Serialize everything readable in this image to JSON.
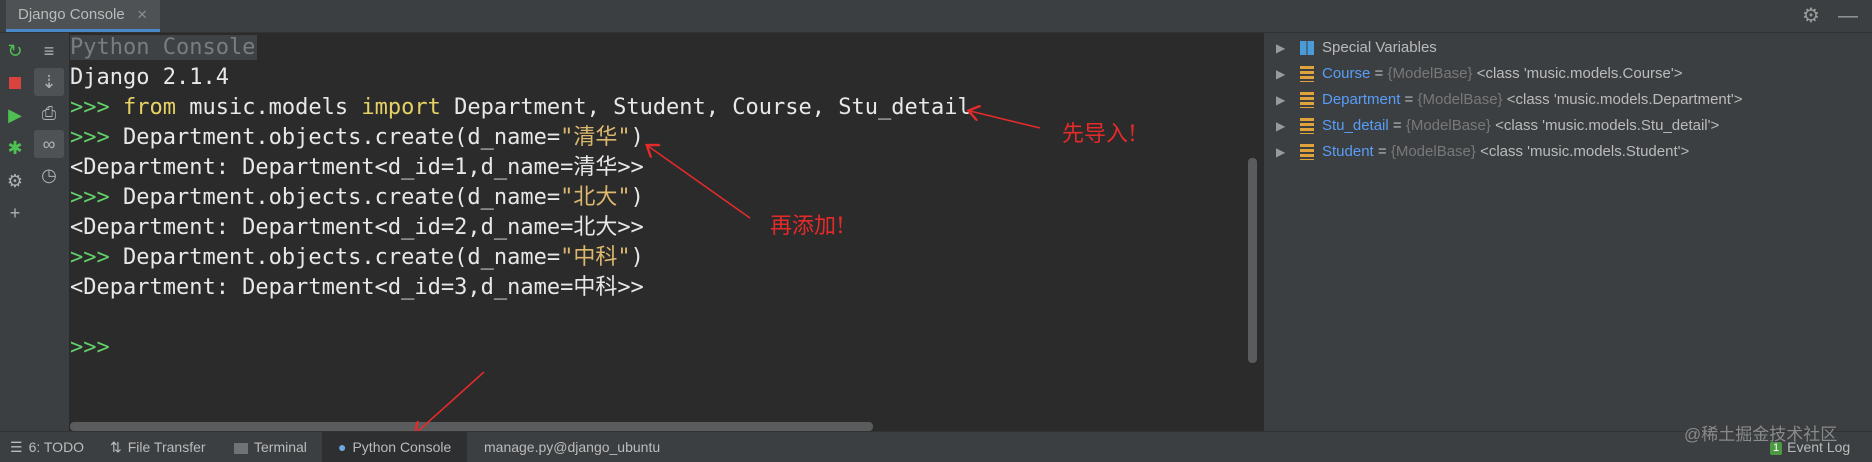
{
  "window": {
    "tab_title": "Django Console",
    "tab_close": "✕",
    "settings_icon": "gear-icon",
    "minimize_icon": "minus-icon"
  },
  "toolbar": {
    "icons": [
      "rerun-icon",
      "stop-icon",
      "run-icon",
      "debug-icon",
      "settings-icon",
      "add-icon"
    ],
    "icons2": [
      "soft-wrap-icon",
      "scroll-to-end-icon",
      "print-icon",
      "show-variables-icon",
      "history-icon"
    ]
  },
  "console": {
    "header": "Python Console",
    "lines": [
      {
        "kind": "output",
        "text": "Django 2.1.4"
      },
      {
        "kind": "input",
        "prompt": ">>> ",
        "kw1": "from",
        "mid": " music.models ",
        "kw2": "import",
        "rest": " Department, Student, Course, Stu_detail"
      },
      {
        "kind": "call",
        "prompt": ">>> ",
        "pre": "Department.objects.create(d_name=",
        "str": "\"清华\"",
        "post": ")"
      },
      {
        "kind": "output",
        "text": "<Department: Department<d_id=1,d_name=清华>>"
      },
      {
        "kind": "call",
        "prompt": ">>> ",
        "pre": "Department.objects.create(d_name=",
        "str": "\"北大\"",
        "post": ")"
      },
      {
        "kind": "output",
        "text": "<Department: Department<d_id=2,d_name=北大>>"
      },
      {
        "kind": "call",
        "prompt": ">>> ",
        "pre": "Department.objects.create(d_name=",
        "str": "\"中科\"",
        "post": ")"
      },
      {
        "kind": "output",
        "text": "<Department: Department<d_id=3,d_name=中科>>"
      }
    ],
    "final_prompt": ">>>"
  },
  "annotations": {
    "import_first": "先导入!",
    "then_add": "再添加!"
  },
  "variables": {
    "special": "Special Variables",
    "items": [
      {
        "name": "Course",
        "eq": " = ",
        "type": "{ModelBase}",
        "value": " <class 'music.models.Course'>"
      },
      {
        "name": "Department",
        "eq": " = ",
        "type": "{ModelBase}",
        "value": " <class 'music.models.Department'>"
      },
      {
        "name": "Stu_detail",
        "eq": " = ",
        "type": "{ModelBase}",
        "value": " <class 'music.models.Stu_detail'>"
      },
      {
        "name": "Student",
        "eq": " = ",
        "type": "{ModelBase}",
        "value": " <class 'music.models.Student'>"
      }
    ]
  },
  "bottom": {
    "todo": "6: TODO",
    "file_transfer": "File Transfer",
    "terminal": "Terminal",
    "python_console": "Python Console",
    "manage": "manage.py@django_ubuntu",
    "event_badge": "1",
    "event_log": "Event Log"
  },
  "watermark": "@稀土掘金技术社区",
  "colors": {
    "prompt": "#63d16a",
    "keyword": "#e6d264",
    "string": "#dcb86e",
    "annotation": "#e52a2a",
    "var_name": "#589df6"
  }
}
